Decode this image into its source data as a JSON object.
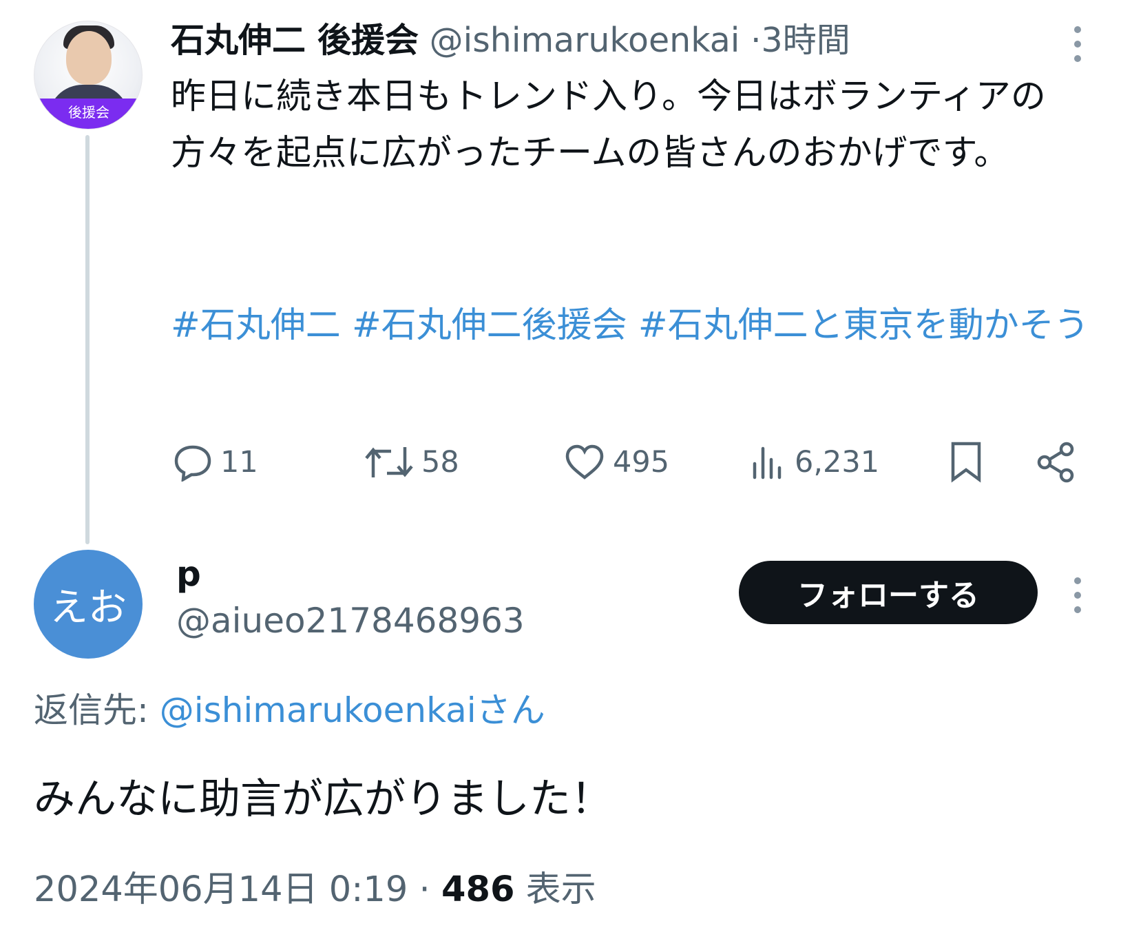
{
  "parent_tweet": {
    "avatar_badge": "後援会",
    "display_name": "石丸伸二 後援会",
    "handle": "@ishimarukoenkai",
    "separator": "·",
    "time": "3時間",
    "text": "昨日に続き本日もトレンド入り。今日はボランティアの方々を起点に広がったチームの皆さんのおかげです。",
    "hashtags": [
      "#石丸伸二",
      "#石丸伸二後援会",
      "#石丸伸二と東京を動かそう"
    ],
    "actions": {
      "replies": "11",
      "retweets": "58",
      "likes": "495",
      "views": "6,231"
    }
  },
  "reply_tweet": {
    "avatar_text": "えお",
    "display_name": "p",
    "handle": "@aiueo2178468963",
    "follow_label": "フォローする",
    "reply_to_label": "返信先:",
    "reply_to_mention": "@ishimarukoenkaiさん",
    "text": "みんなに助言が広がりました！",
    "date": "2024年06月14日 0:19",
    "meta_separator": "·",
    "views_count": "486",
    "views_label": "表示"
  },
  "colors": {
    "link": "#3b8fd6",
    "muted": "#536471",
    "text": "#0f1419",
    "badge_purple": "#7b2cf0",
    "avatar_blue": "#4a8fd6"
  }
}
